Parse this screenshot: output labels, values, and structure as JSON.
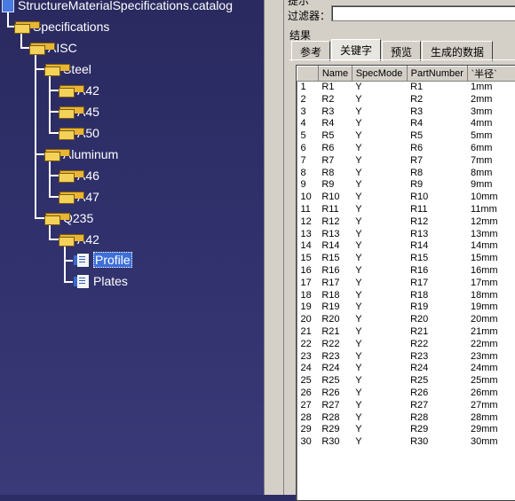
{
  "tree": {
    "root": "StructureMaterialSpecifications.catalog",
    "nodes": {
      "specifications": "Specifications",
      "aisc": "AISC",
      "steel": "Steel",
      "a42_steel": "A42",
      "a45": "A45",
      "a50": "A50",
      "aluminum": "Aluminum",
      "a46": "A46",
      "a47": "A47",
      "q235": "Q235",
      "a42_q235": "A42",
      "profile": "Profile",
      "plates": "Plates"
    },
    "selected": "profile"
  },
  "dialog": {
    "hint_label": "提示",
    "filter_label": "过滤器：",
    "filter_value": "",
    "results_label": "结果",
    "tabs": [
      "参考",
      "关键字",
      "预览",
      "生成的数据"
    ],
    "active_tab": 1,
    "table": {
      "columns": [
        "",
        "Name",
        "SpecMode",
        "PartNumber",
        "`半径`"
      ],
      "rows": [
        [
          "1",
          "R1",
          "Y",
          "R1",
          "1mm"
        ],
        [
          "2",
          "R2",
          "Y",
          "R2",
          "2mm"
        ],
        [
          "3",
          "R3",
          "Y",
          "R3",
          "3mm"
        ],
        [
          "4",
          "R4",
          "Y",
          "R4",
          "4mm"
        ],
        [
          "5",
          "R5",
          "Y",
          "R5",
          "5mm"
        ],
        [
          "6",
          "R6",
          "Y",
          "R6",
          "6mm"
        ],
        [
          "7",
          "R7",
          "Y",
          "R7",
          "7mm"
        ],
        [
          "8",
          "R8",
          "Y",
          "R8",
          "8mm"
        ],
        [
          "9",
          "R9",
          "Y",
          "R9",
          "9mm"
        ],
        [
          "10",
          "R10",
          "Y",
          "R10",
          "10mm"
        ],
        [
          "11",
          "R11",
          "Y",
          "R11",
          "11mm"
        ],
        [
          "12",
          "R12",
          "Y",
          "R12",
          "12mm"
        ],
        [
          "13",
          "R13",
          "Y",
          "R13",
          "13mm"
        ],
        [
          "14",
          "R14",
          "Y",
          "R14",
          "14mm"
        ],
        [
          "15",
          "R15",
          "Y",
          "R15",
          "15mm"
        ],
        [
          "16",
          "R16",
          "Y",
          "R16",
          "16mm"
        ],
        [
          "17",
          "R17",
          "Y",
          "R17",
          "17mm"
        ],
        [
          "18",
          "R18",
          "Y",
          "R18",
          "18mm"
        ],
        [
          "19",
          "R19",
          "Y",
          "R19",
          "19mm"
        ],
        [
          "20",
          "R20",
          "Y",
          "R20",
          "20mm"
        ],
        [
          "21",
          "R21",
          "Y",
          "R21",
          "21mm"
        ],
        [
          "22",
          "R22",
          "Y",
          "R22",
          "22mm"
        ],
        [
          "23",
          "R23",
          "Y",
          "R23",
          "23mm"
        ],
        [
          "24",
          "R24",
          "Y",
          "R24",
          "24mm"
        ],
        [
          "25",
          "R25",
          "Y",
          "R25",
          "25mm"
        ],
        [
          "26",
          "R26",
          "Y",
          "R26",
          "26mm"
        ],
        [
          "27",
          "R27",
          "Y",
          "R27",
          "27mm"
        ],
        [
          "28",
          "R28",
          "Y",
          "R28",
          "28mm"
        ],
        [
          "29",
          "R29",
          "Y",
          "R29",
          "29mm"
        ],
        [
          "30",
          "R30",
          "Y",
          "R30",
          "30mm"
        ]
      ]
    }
  },
  "colors": {
    "tree_background": "#2d2d66",
    "dialog_background": "#d4d0c8",
    "selection": "#3e6fd8"
  }
}
